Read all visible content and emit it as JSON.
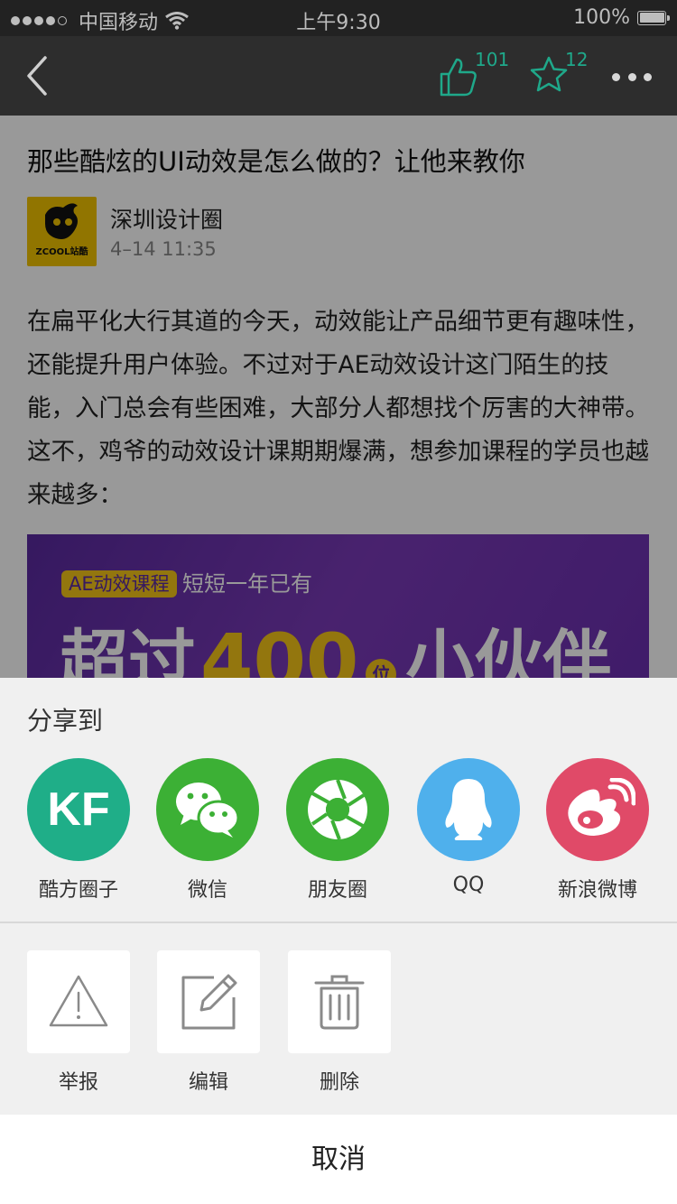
{
  "status_bar": {
    "carrier": "中国移动",
    "time": "上午9:30",
    "battery": "100%",
    "battery_level": 1.0
  },
  "nav": {
    "like_count": "101",
    "favorite_count": "12",
    "accent_color": "#1fa88a",
    "icons": [
      "back-arrow-icon",
      "thumbs-up-icon",
      "star-icon",
      "more-dots-icon"
    ]
  },
  "article": {
    "title": "那些酷炫的UI动效是怎么做的？让他来教你",
    "author": "深圳设计圈",
    "time": "4–14 11:35",
    "logo_text": "ZCOOL站酷",
    "body": "在扁平化大行其道的今天，动效能让产品细节更有趣味性，还能提升用户体验。不过对于AE动效设计这门陌生的技能，入门总会有些困难，大部分人都想找个厉害的大神带。这不，鸡爷的动效设计课期期爆满，想参加课程的学员也越来越多：",
    "banner": {
      "tag": "AE动效课程",
      "subtitle": "短短一年已有",
      "prefix": "超过",
      "number": "400",
      "unit": "位",
      "suffix": "小伙伴"
    }
  },
  "share_sheet": {
    "title": "分享到",
    "items": [
      {
        "label": "酷方圈子",
        "icon": "kf-icon",
        "text": "KF",
        "color": "#1fae88"
      },
      {
        "label": "微信",
        "icon": "wechat-icon",
        "color": "#3cb035"
      },
      {
        "label": "朋友圈",
        "icon": "moments-icon",
        "color": "#3cb035"
      },
      {
        "label": "QQ",
        "icon": "qq-icon",
        "color": "#4fb0ec"
      },
      {
        "label": "新浪微博",
        "icon": "weibo-icon",
        "color": "#e04a68"
      }
    ],
    "actions": [
      {
        "label": "举报",
        "icon": "warning-icon"
      },
      {
        "label": "编辑",
        "icon": "edit-icon"
      },
      {
        "label": "删除",
        "icon": "trash-icon"
      }
    ],
    "cancel": "取消"
  }
}
